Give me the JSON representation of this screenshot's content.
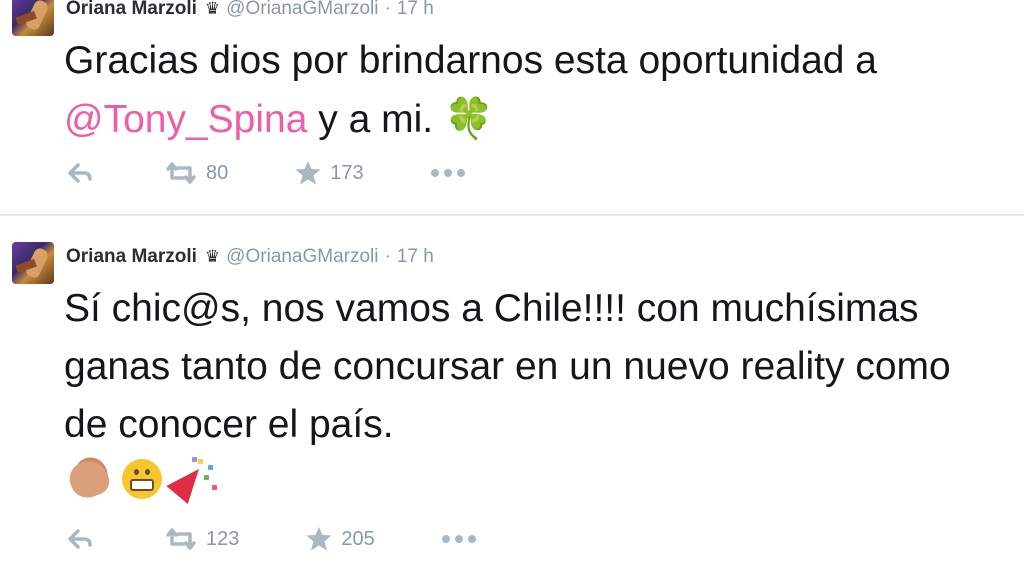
{
  "tweets": [
    {
      "author_name": "Oriana Marzoli",
      "badge_glyph": "♛",
      "handle": "@OrianaGMarzoli",
      "separator": "·",
      "time": "17 h",
      "text_before": "Gracias dios por brindarnos esta oportunidad a ",
      "mention": "@Tony_Spina",
      "text_after": " y a mi. ",
      "emoji": "🍀",
      "retweets": "80",
      "favorites": "173"
    },
    {
      "author_name": "Oriana Marzoli",
      "badge_glyph": "♛",
      "handle": "@OrianaGMarzoli",
      "separator": "·",
      "time": "17 h",
      "text": "Sí chic@s, nos vamos a Chile!!!! con muchísimas ganas tanto de concursar en un nuevo reality como de conocer el país.",
      "emojis": [
        "clapping-hands",
        "grinning-face",
        "party-popper"
      ],
      "retweets": "123",
      "favorites": "205"
    }
  ],
  "icons": {
    "reply": "reply-icon",
    "retweet": "retweet-icon",
    "favorite": "star-icon",
    "more": "more-icon"
  },
  "colors": {
    "mention": "#ef5da8",
    "meta": "#8899a6",
    "text": "#14171a",
    "divider": "#e1e8ed"
  }
}
